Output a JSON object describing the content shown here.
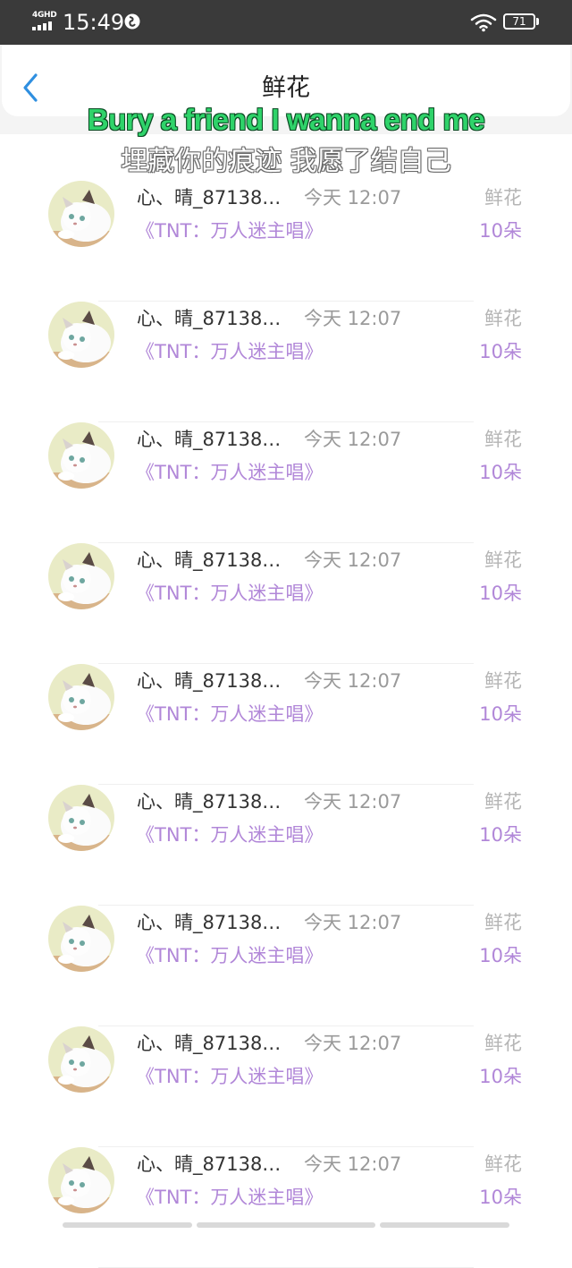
{
  "status_bar": {
    "network": "4GHD",
    "time": "15:49",
    "battery": "71"
  },
  "header": {
    "title": "鲜花"
  },
  "subtitles": {
    "english": "Bury a friend I wanna end me",
    "chinese": "埋藏你的痕迹 我愿了结自己"
  },
  "list": {
    "items": [
      {
        "user": "心、晴_87138…",
        "time": "今天 12:07",
        "gift": "鲜花",
        "song": "《TNT：万人迷主唱》",
        "count": "10朵"
      },
      {
        "user": "心、晴_87138…",
        "time": "今天 12:07",
        "gift": "鲜花",
        "song": "《TNT：万人迷主唱》",
        "count": "10朵"
      },
      {
        "user": "心、晴_87138…",
        "time": "今天 12:07",
        "gift": "鲜花",
        "song": "《TNT：万人迷主唱》",
        "count": "10朵"
      },
      {
        "user": "心、晴_87138…",
        "time": "今天 12:07",
        "gift": "鲜花",
        "song": "《TNT：万人迷主唱》",
        "count": "10朵"
      },
      {
        "user": "心、晴_87138…",
        "time": "今天 12:07",
        "gift": "鲜花",
        "song": "《TNT：万人迷主唱》",
        "count": "10朵"
      },
      {
        "user": "心、晴_87138…",
        "time": "今天 12:07",
        "gift": "鲜花",
        "song": "《TNT：万人迷主唱》",
        "count": "10朵"
      },
      {
        "user": "心、晴_87138…",
        "time": "今天 12:07",
        "gift": "鲜花",
        "song": "《TNT：万人迷主唱》",
        "count": "10朵"
      },
      {
        "user": "心、晴_87138…",
        "time": "今天 12:07",
        "gift": "鲜花",
        "song": "《TNT：万人迷主唱》",
        "count": "10朵"
      },
      {
        "user": "心、晴_87138…",
        "time": "今天 12:07",
        "gift": "鲜花",
        "song": "《TNT：万人迷主唱》",
        "count": "10朵"
      }
    ]
  },
  "colors": {
    "accent_purple": "#b187d8",
    "back_blue": "#2f8fe0",
    "subtitle_green": "#2fd36a"
  },
  "icons": {
    "back": "chevron-left-icon",
    "avatar": "cat-avatar"
  }
}
